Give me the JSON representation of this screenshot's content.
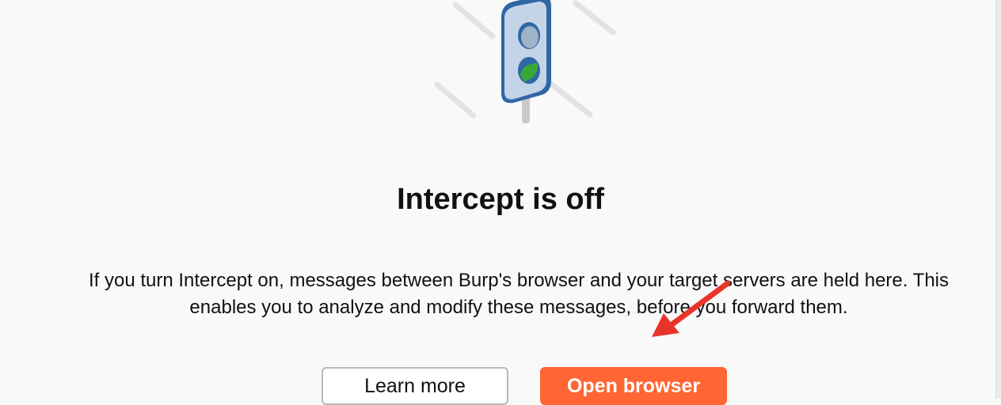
{
  "intercept": {
    "title": "Intercept is off",
    "description": "If you turn Intercept on, messages between Burp's browser and your target servers are held here. This enables you to analyze and modify these messages, before you forward them."
  },
  "buttons": {
    "learn_more": "Learn more",
    "open_browser": "Open browser"
  },
  "icons": {
    "illustration": "traffic-light-icon",
    "annotation": "red-arrow-annotation"
  },
  "colors": {
    "accent": "#ff6633",
    "traffic_light_body": "#2f67a5",
    "green_light": "#3aa836",
    "arrow": "#e8352a"
  }
}
